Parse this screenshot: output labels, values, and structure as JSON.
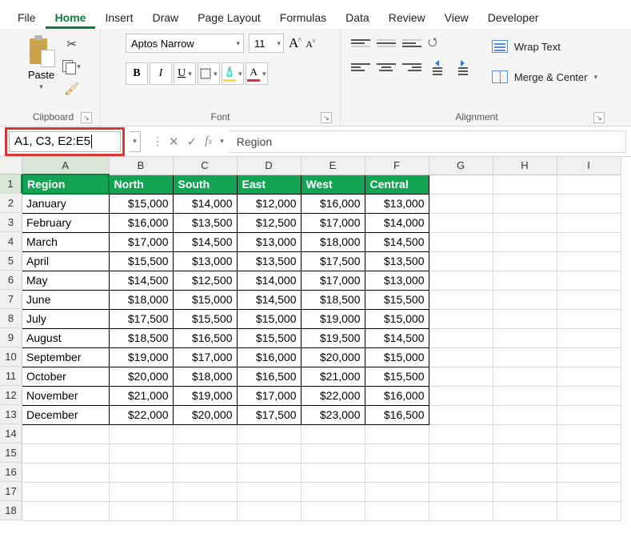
{
  "tabs": {
    "file": "File",
    "home": "Home",
    "insert": "Insert",
    "draw": "Draw",
    "page_layout": "Page Layout",
    "formulas": "Formulas",
    "data": "Data",
    "review": "Review",
    "view": "View",
    "developer": "Developer"
  },
  "ribbon": {
    "clipboard": {
      "paste": "Paste",
      "group": "Clipboard"
    },
    "font": {
      "name": "Aptos Narrow",
      "size": "11",
      "group": "Font",
      "bold": "B",
      "italic": "I",
      "underline": "U"
    },
    "alignment": {
      "wrap": "Wrap Text",
      "merge": "Merge & Center",
      "group": "Alignment"
    }
  },
  "name_box": "A1, C3, E2:E5",
  "formula_bar": "Region",
  "columns": [
    "A",
    "B",
    "C",
    "D",
    "E",
    "F",
    "G",
    "H",
    "I"
  ],
  "row_numbers": [
    1,
    2,
    3,
    4,
    5,
    6,
    7,
    8,
    9,
    10,
    11,
    12,
    13,
    14,
    15,
    16,
    17,
    18
  ],
  "headers": [
    "Region",
    "North",
    "South",
    "East",
    "West",
    "Central"
  ],
  "rows": [
    {
      "m": "January",
      "v": [
        "$15,000",
        "$14,000",
        "$12,000",
        "$16,000",
        "$13,000"
      ]
    },
    {
      "m": "February",
      "v": [
        "$16,000",
        "$13,500",
        "$12,500",
        "$17,000",
        "$14,000"
      ]
    },
    {
      "m": "March",
      "v": [
        "$17,000",
        "$14,500",
        "$13,000",
        "$18,000",
        "$14,500"
      ]
    },
    {
      "m": "April",
      "v": [
        "$15,500",
        "$13,000",
        "$13,500",
        "$17,500",
        "$13,500"
      ]
    },
    {
      "m": "May",
      "v": [
        "$14,500",
        "$12,500",
        "$14,000",
        "$17,000",
        "$13,000"
      ]
    },
    {
      "m": "June",
      "v": [
        "$18,000",
        "$15,000",
        "$14,500",
        "$18,500",
        "$15,500"
      ]
    },
    {
      "m": "July",
      "v": [
        "$17,500",
        "$15,500",
        "$15,000",
        "$19,000",
        "$15,000"
      ]
    },
    {
      "m": "August",
      "v": [
        "$18,500",
        "$16,500",
        "$15,500",
        "$19,500",
        "$14,500"
      ]
    },
    {
      "m": "September",
      "v": [
        "$19,000",
        "$17,000",
        "$16,000",
        "$20,000",
        "$15,000"
      ]
    },
    {
      "m": "October",
      "v": [
        "$20,000",
        "$18,000",
        "$16,500",
        "$21,000",
        "$15,500"
      ]
    },
    {
      "m": "November",
      "v": [
        "$21,000",
        "$19,000",
        "$17,000",
        "$22,000",
        "$16,000"
      ]
    },
    {
      "m": "December",
      "v": [
        "$22,000",
        "$20,000",
        "$17,500",
        "$23,000",
        "$16,500"
      ]
    }
  ],
  "chart_data": {
    "type": "table",
    "title": "Region",
    "columns": [
      "Region",
      "North",
      "South",
      "East",
      "West",
      "Central"
    ],
    "categories": [
      "January",
      "February",
      "March",
      "April",
      "May",
      "June",
      "July",
      "August",
      "September",
      "October",
      "November",
      "December"
    ],
    "series": [
      {
        "name": "North",
        "values": [
          15000,
          16000,
          17000,
          15500,
          14500,
          18000,
          17500,
          18500,
          19000,
          20000,
          21000,
          22000
        ]
      },
      {
        "name": "South",
        "values": [
          14000,
          13500,
          14500,
          13000,
          12500,
          15000,
          15500,
          16500,
          17000,
          18000,
          19000,
          20000
        ]
      },
      {
        "name": "East",
        "values": [
          12000,
          12500,
          13000,
          13500,
          14000,
          14500,
          15000,
          15500,
          16000,
          16500,
          17000,
          17500
        ]
      },
      {
        "name": "West",
        "values": [
          16000,
          17000,
          18000,
          17500,
          17000,
          18500,
          19000,
          19500,
          20000,
          21000,
          22000,
          23000
        ]
      },
      {
        "name": "Central",
        "values": [
          13000,
          14000,
          14500,
          13500,
          13000,
          15500,
          15000,
          14500,
          15000,
          15500,
          16000,
          16500
        ]
      }
    ]
  }
}
